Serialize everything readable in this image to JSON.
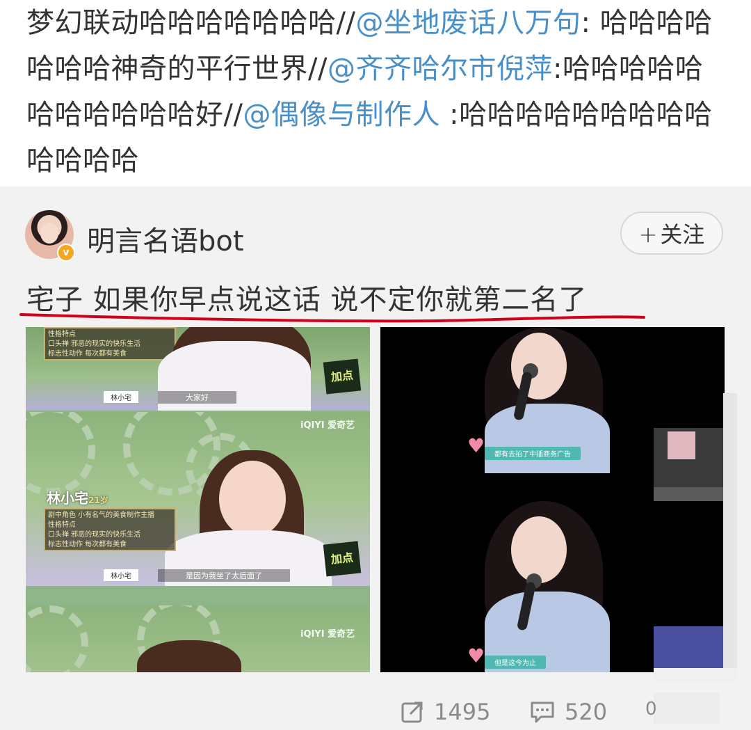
{
  "repost": {
    "seg1": "梦幻联动哈哈哈哈哈哈哈//",
    "mention1": "@坐地废话八万句",
    "seg2": ": 哈哈哈哈哈哈哈神奇的平行世界//",
    "mention2": "@齐齐哈尔市倪萍",
    "seg3": ":哈哈哈哈哈哈哈哈哈哈哈好//",
    "mention3": "@偶像与制作人",
    "seg4": " :哈哈哈哈哈哈哈哈哈哈哈哈哈"
  },
  "post": {
    "author": "明言名语bot",
    "verified_badge": "v",
    "follow_label": "关注",
    "follow_plus": "+",
    "text": "宅子 如果你早点说这话 说不定你就第二名了"
  },
  "images": {
    "left": {
      "top_name_tag": "林小宅",
      "top_caption": "大家好",
      "mid_name": "林小宅",
      "mid_age": "21岁",
      "info_lines": [
        "剧中角色 小有名气的美食制作主播",
        "性格特点",
        "口头禅 邪恶的现实的快乐生活",
        "标志性动作 每次都有美食"
      ],
      "info_top_lines": [
        "性格特点",
        "口头禅 邪恶的现实的快乐生活",
        "标志性动作 每次都有美食"
      ],
      "mid_name_tag": "林小宅",
      "mid_caption": "是因为我坐了太后面了",
      "watermark": "iQIYI 爱奇艺",
      "show_logo": "加点"
    },
    "right": {
      "top_caption": "都有去拍了中插商务广告",
      "bottom_caption": "但是这今为止"
    }
  },
  "footer": {
    "repost_count": "1495",
    "comment_count": "520",
    "like_partial": "0"
  },
  "colors": {
    "mention": "#4a90c8",
    "text": "#333333",
    "card_bg": "#f2f2f2",
    "underline": "#d0021b",
    "footer": "#8a8a8a"
  },
  "icons": {
    "repost": "share-square-icon",
    "comment": "comment-bubble-icon",
    "like": "thumb-icon"
  }
}
